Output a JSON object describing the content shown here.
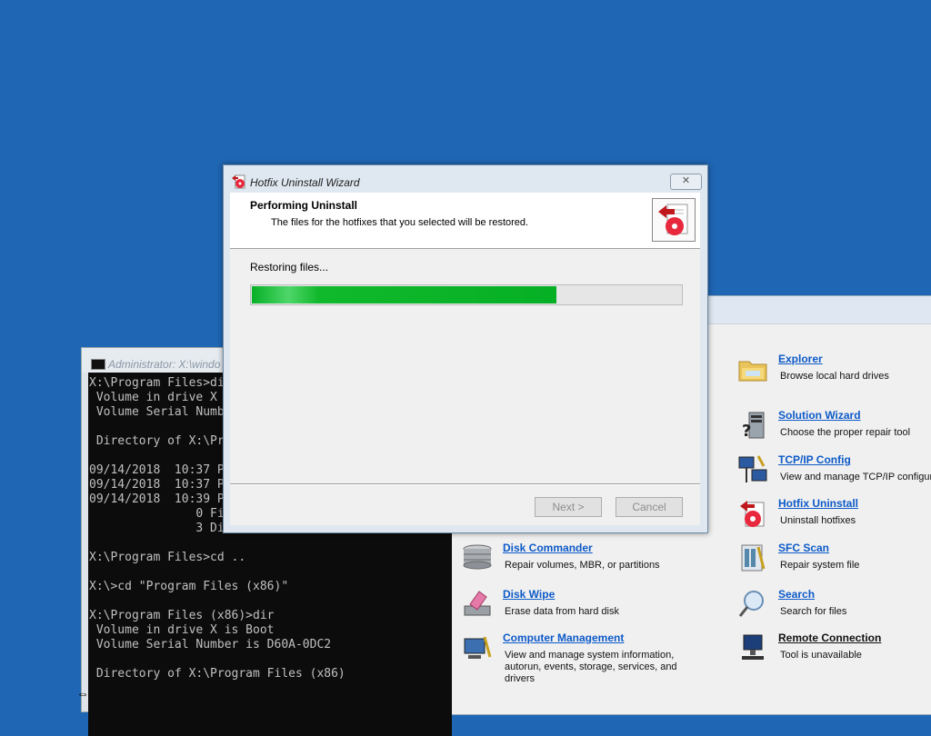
{
  "wizard": {
    "title": "Hotfix Uninstall Wizard",
    "close_label": "✕",
    "header_title": "Performing Uninstall",
    "header_subtitle": "The files for the hotfixes that you selected will be restored.",
    "status_text": "Restoring files...",
    "progress": 0.71,
    "progress_color": "#06b025",
    "next_label": "Next >",
    "cancel_label": "Cancel"
  },
  "console": {
    "title": "Administrator: X:\\windo",
    "lines": "X:\\Program Files>di\n Volume in drive X\n Volume Serial Numb\n\n Directory of X:\\Pr\n\n09/14/2018  10:37 P\n09/14/2018  10:37 P\n09/14/2018  10:39 P\n               0 Fi\n               3 Di\n\nX:\\Program Files>cd ..\n\nX:\\>cd \"Program Files (x86)\"\n\nX:\\Program Files (x86)>dir\n Volume in drive X is Boot\n Volume Serial Number is D60A-0DC2\n\n Directory of X:\\Program Files (x86)"
  },
  "tools": [
    {
      "name": "Explorer",
      "desc": "Browse local hard drives",
      "icon": "folder-icon"
    },
    {
      "name": "Solution Wizard",
      "desc": "Choose the proper repair tool",
      "icon": "solution-wizard-icon"
    },
    {
      "name": "TCP/IP Config",
      "desc": "View and manage TCP/IP configura",
      "icon": "network-config-icon"
    },
    {
      "name": "Hotfix Uninstall",
      "desc": "Uninstall hotfixes",
      "icon": "hotfix-icon"
    },
    {
      "name": "SFC Scan",
      "desc": "Repair system file",
      "icon": "sfc-scan-icon"
    },
    {
      "name": "Search",
      "desc": "Search for files",
      "icon": "search-icon"
    },
    {
      "name": "Remote Connection",
      "desc": "Tool is unavailable",
      "icon": "remote-connection-icon"
    },
    {
      "name": "Disk Commander",
      "desc": "Repair volumes, MBR, or partitions",
      "icon": "disk-commander-icon"
    },
    {
      "name": "Disk Wipe",
      "desc": "Erase data from hard disk",
      "icon": "disk-wipe-icon"
    },
    {
      "name": "Computer Management",
      "desc": "View and manage system information,\nautorun, events, storage, services, and\ndrivers",
      "icon": "computer-management-icon"
    }
  ],
  "colors": {
    "desktop": "#1f66b4",
    "link": "#0d5ac8"
  }
}
